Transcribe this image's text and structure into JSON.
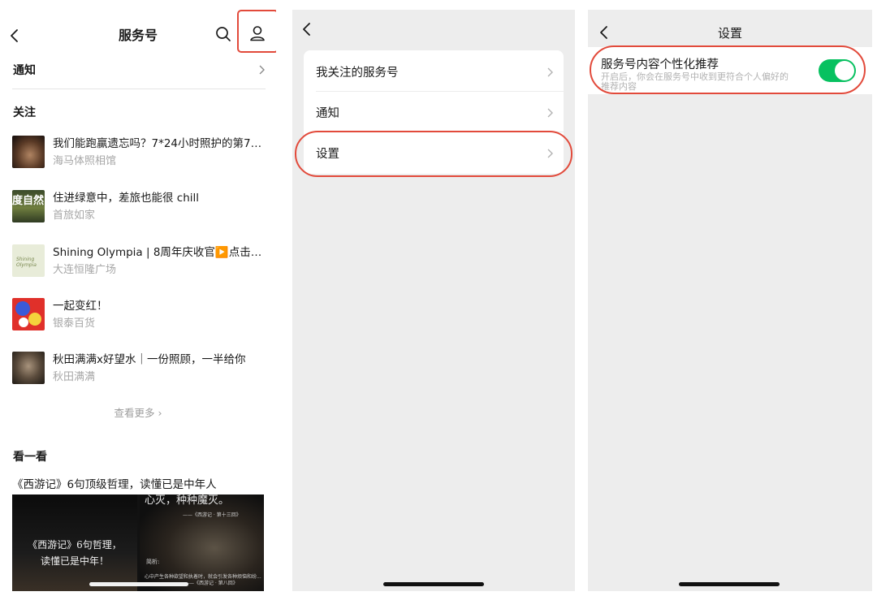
{
  "accent_red": "#e24a3b",
  "toggle_color": "#07c160",
  "panel1": {
    "title": "服务号",
    "icons": [
      "back-icon",
      "search-icon",
      "user-icon",
      "chevron-right-icon"
    ],
    "notice_label": "通知",
    "follow_header": "关注",
    "accounts": [
      {
        "headline": "我们能跑赢遗忘吗？7*24小时照护的第70...",
        "name": "海马体照相馆"
      },
      {
        "headline": "住进绿意中，差旅也能很 chill",
        "name": "首旅如家",
        "thumb_text": "度自然"
      },
      {
        "headline": "Shining Olympia | 8周年庆收官▶️点击查...",
        "name": "大连恒隆广场"
      },
      {
        "headline": "一起变红！",
        "name": "银泰百货"
      },
      {
        "headline": "秋田满满x好望水｜一份照顾，一半给你",
        "name": "秋田满满"
      }
    ],
    "see_more": "查看更多 ›",
    "look_header": "看一看",
    "article": {
      "title": "《西游记》6句顶级哲理，读懂已是中年人",
      "image_text_1": "《西游记》6句哲理，",
      "image_text_2": "读懂已是中年！",
      "image_text_3": "心灭，种种魔灭。",
      "image_text_4": "——《西游记 · 第十三回》",
      "image_text_5": "简析:",
      "image_text_6": "心中产生各种欲望和执着时，就会引发各种烦恼和纷...",
      "image_text_7": "——《西游记 · 第八回》"
    }
  },
  "panel2": {
    "items": [
      {
        "label": "我关注的服务号"
      },
      {
        "label": "通知"
      },
      {
        "label": "设置"
      }
    ]
  },
  "panel3": {
    "title": "设置",
    "setting_label": "服务号内容个性化推荐",
    "setting_desc": "开启后，你会在服务号中收到更符合个人偏好的推荐内容",
    "toggle_on": true
  }
}
